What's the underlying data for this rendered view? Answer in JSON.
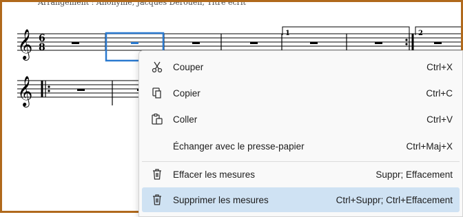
{
  "score": {
    "credits_text": "Arrangement : Anonyme, Jacques Derouen, Titre écrit",
    "time_signature_top": "6",
    "time_signature_bottom": "8",
    "volta_1": "1",
    "volta_2": "2"
  },
  "context_menu": {
    "items": [
      {
        "label": "Couper",
        "shortcut": "Ctrl+X",
        "icon": "scissors-icon"
      },
      {
        "label": "Copier",
        "shortcut": "Ctrl+C",
        "icon": "copy-icon"
      },
      {
        "label": "Coller",
        "shortcut": "Ctrl+V",
        "icon": "paste-icon"
      },
      {
        "label": "Échanger avec le presse-papier",
        "shortcut": "Ctrl+Maj+X",
        "icon": ""
      },
      {
        "label": "Effacer les mesures",
        "shortcut": "Suppr; Effacement",
        "icon": "trash-icon"
      },
      {
        "label": "Supprimer les mesures",
        "shortcut": "Ctrl+Suppr; Ctrl+Effacement",
        "icon": "trash-icon"
      }
    ],
    "highlighted_index": 5
  },
  "colors": {
    "frame_border": "#b0691c",
    "selection": "#2b7ad0",
    "highlight": "#cfe2f3"
  }
}
